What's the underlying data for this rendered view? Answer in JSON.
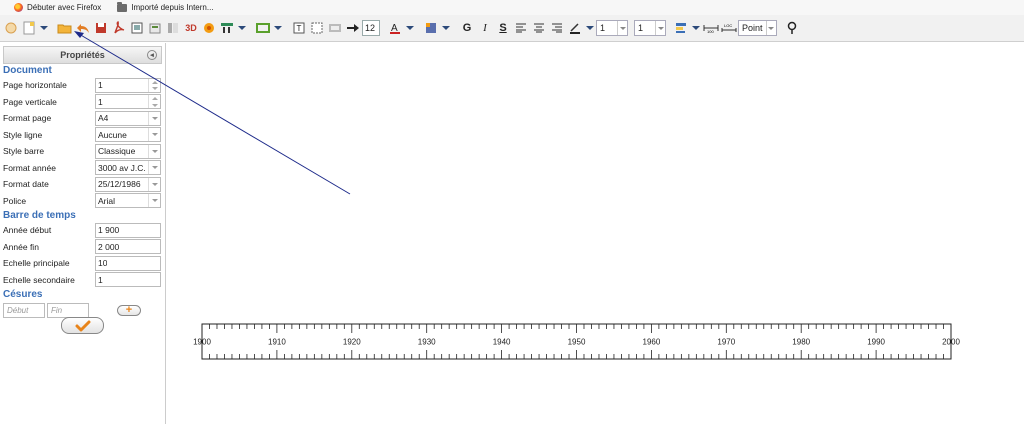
{
  "bookmarks": [
    {
      "label": "Débuter avec Firefox",
      "icon": "firefox-icon"
    },
    {
      "label": "Importé depuis Intern...",
      "icon": "folder-icon"
    }
  ],
  "toolbar": {
    "font_size": "12",
    "spin1": "1",
    "spin2": "1",
    "unit": "Point",
    "text_colour": "#cc2222"
  },
  "panel": {
    "title": "Propriétés",
    "document_header": "Document",
    "fields": [
      {
        "label": "Page horizontale",
        "value": "1",
        "kind": "spinner"
      },
      {
        "label": "Page verticale",
        "value": "1",
        "kind": "spinner"
      },
      {
        "label": "Format page",
        "value": "A4",
        "kind": "select"
      },
      {
        "label": "Style ligne",
        "value": "Aucune",
        "kind": "select"
      },
      {
        "label": "Style barre",
        "value": "Classique",
        "kind": "select"
      },
      {
        "label": "Format année",
        "value": "3000 av J.C.",
        "kind": "select"
      },
      {
        "label": "Format date",
        "value": "25/12/1986",
        "kind": "select"
      },
      {
        "label": "Police",
        "value": "Arial",
        "kind": "select"
      }
    ],
    "timebar_header": "Barre de temps",
    "timebar_fields": [
      {
        "label": "Année début",
        "value": "1 900"
      },
      {
        "label": "Année fin",
        "value": "2 000"
      },
      {
        "label": "Echelle principale",
        "value": "10"
      },
      {
        "label": "Echelle secondaire",
        "value": "1"
      }
    ],
    "cesures_header": "Césures",
    "cesure_start_placeholder": "Début",
    "cesure_end_placeholder": "Fin",
    "add_label": "+"
  },
  "timeline": {
    "start": 1900,
    "end": 2000,
    "major_step": 10,
    "minor_step": 1,
    "labels": [
      "1900",
      "1910",
      "1920",
      "1930",
      "1940",
      "1950",
      "1960",
      "1970",
      "1980",
      "1990",
      "2000"
    ]
  },
  "accent": "#3b6fb6",
  "ok_color": "#e8841a"
}
